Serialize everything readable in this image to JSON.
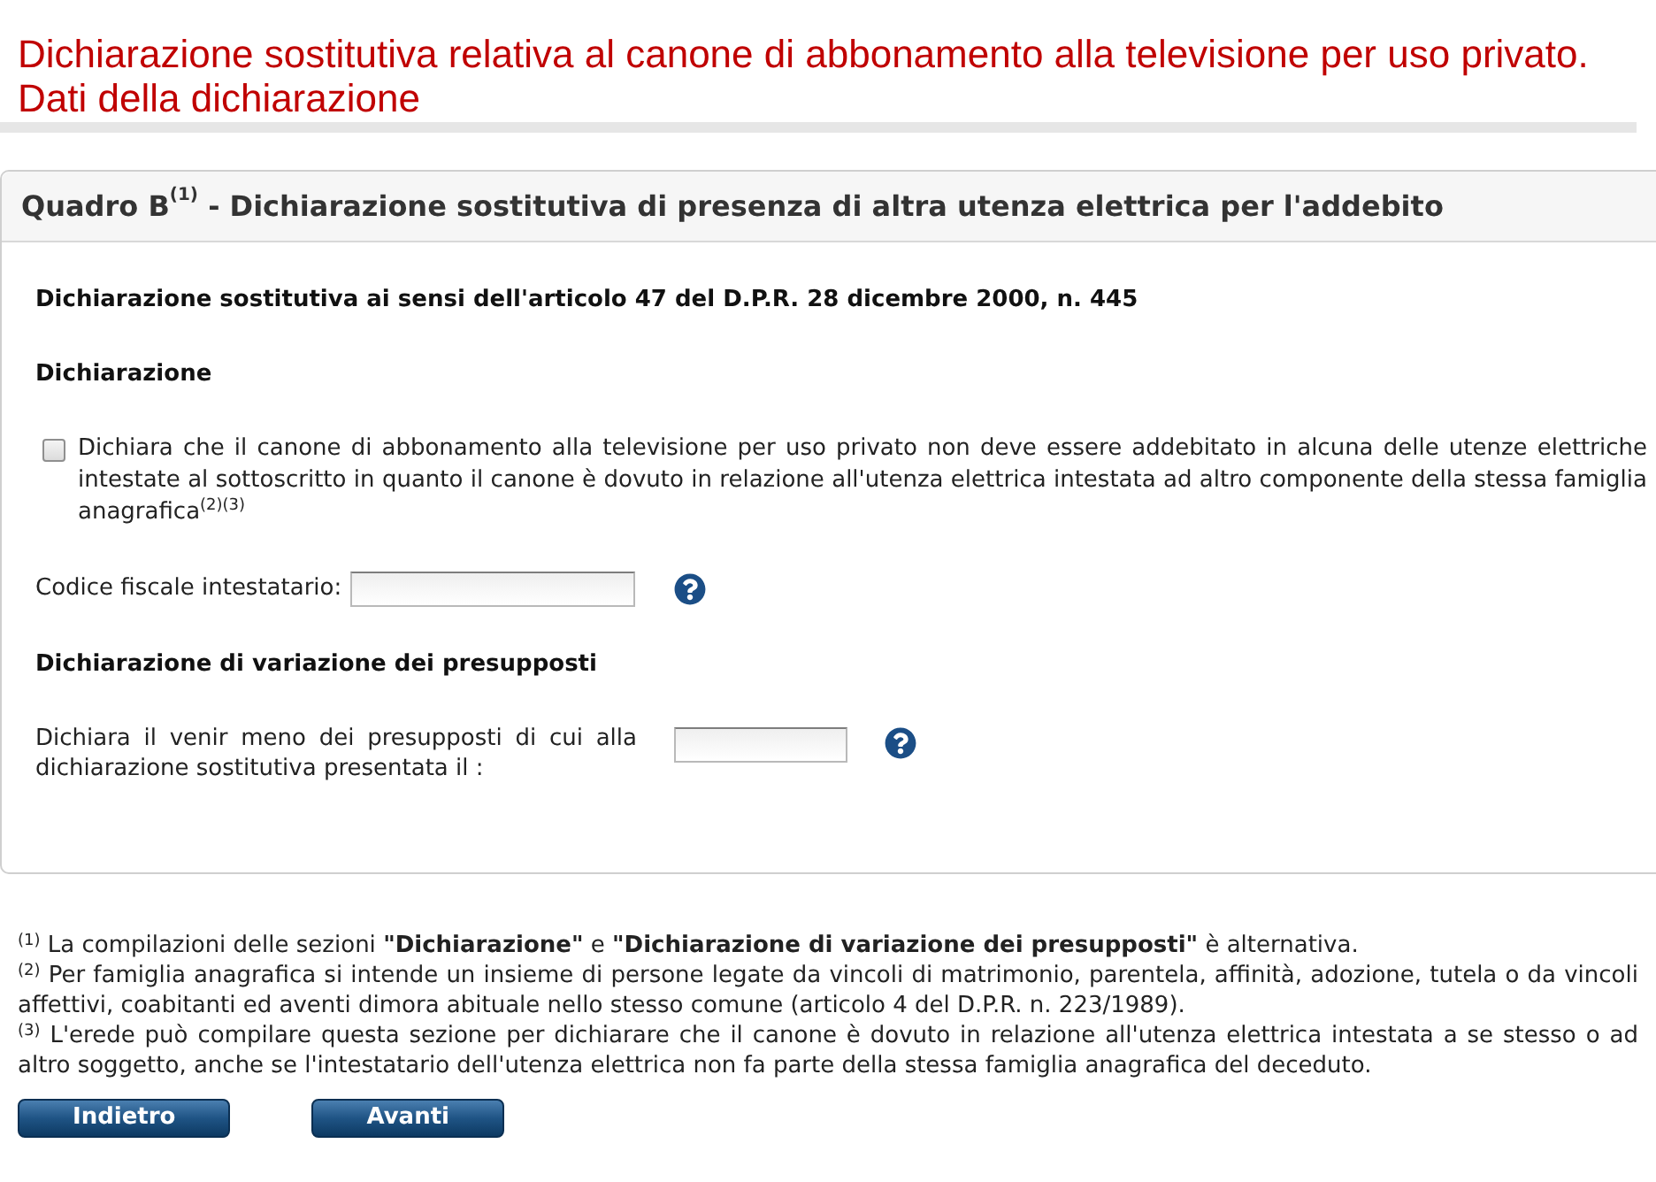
{
  "page_title": {
    "lines": [
      "Dichiarazione sostitutiva relativa al canone di abbonamento alla televisione per uso privato.",
      "Dati della dichiarazione"
    ]
  },
  "panel": {
    "title": "Quadro B$^{(1)}$ - Dichiarazione sostitutiva di presenza di altra utenza elettrica per l'addebito",
    "items": [
      {
        "kind": "heading",
        "text": "Dichiarazione sostitutiva ai sensi dell'articolo 47 del D.P.R. 28 dicembre 2000, n. 445"
      },
      {
        "kind": "heading",
        "text": "Dichiarazione"
      },
      {
        "kind": "checkbox",
        "label": "Dichiara che il canone di abbonamento alla televisione per uso privato non deve essere addebitato in alcuna delle utenze elettriche intestate al sottoscritto in quanto il canone è dovuto in relazione all'utenza elettrica intestata ad altro componente della stessa famiglia anagrafica$^{(2)(3)}$",
        "checked": false
      },
      {
        "kind": "textfield",
        "label": "Codice fiscale intestatario:",
        "help": true
      },
      {
        "kind": "heading",
        "text": "Dichiarazione di variazione dei presupposti"
      },
      {
        "kind": "datefield",
        "label": "Dichiara il venir meno dei presupposti di cui alla dichiarazione sostitutiva presentata il :",
        "help": true
      }
    ]
  },
  "footnotes": [
    "$^{(1)}$ La compilazioni delle sezioni **\"Dichiarazione\"** e **\"Dichiarazione di variazione dei presupposti\"** è alternativa.",
    "$^{(2)}$ Per famiglia anagrafica si intende un insieme di persone legate da vincoli di matrimonio, parentela, affinità, adozione, tutela o da vincoli affettivi, coabitanti ed aventi dimora abituale nello stesso comune (articolo 4 del D.P.R. n. 223/1989).",
    "$^{(3)}$ L'erede può compilare questa sezione per dichiarare che il canone è dovuto in relazione all'utenza elettrica intestata a se stesso o ad altro soggetto, anche se l'intestatario dell'utenza elettrica non fa parte della stessa famiglia anagrafica del deceduto."
  ],
  "buttons": [
    "Indietro",
    "Avanti"
  ]
}
